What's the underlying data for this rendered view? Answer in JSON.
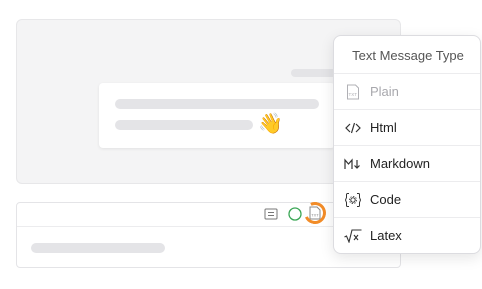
{
  "preview": {
    "emoji": "👋"
  },
  "composer": {
    "tools": [
      "list-icon",
      "circle-icon",
      "txt-file-icon"
    ]
  },
  "menu": {
    "title": "Text Message Type",
    "items": [
      {
        "label": "Plain",
        "icon": "txt-file-icon",
        "disabled": true
      },
      {
        "label": "Html",
        "icon": "code-brackets-icon",
        "disabled": false
      },
      {
        "label": "Markdown",
        "icon": "markdown-icon",
        "disabled": false
      },
      {
        "label": "Code",
        "icon": "code-settings-icon",
        "disabled": false
      },
      {
        "label": "Latex",
        "icon": "sqrt-icon",
        "disabled": false
      }
    ]
  },
  "colors": {
    "accent_ring": "#f28c28",
    "placeholder": "#e4e4e7"
  }
}
